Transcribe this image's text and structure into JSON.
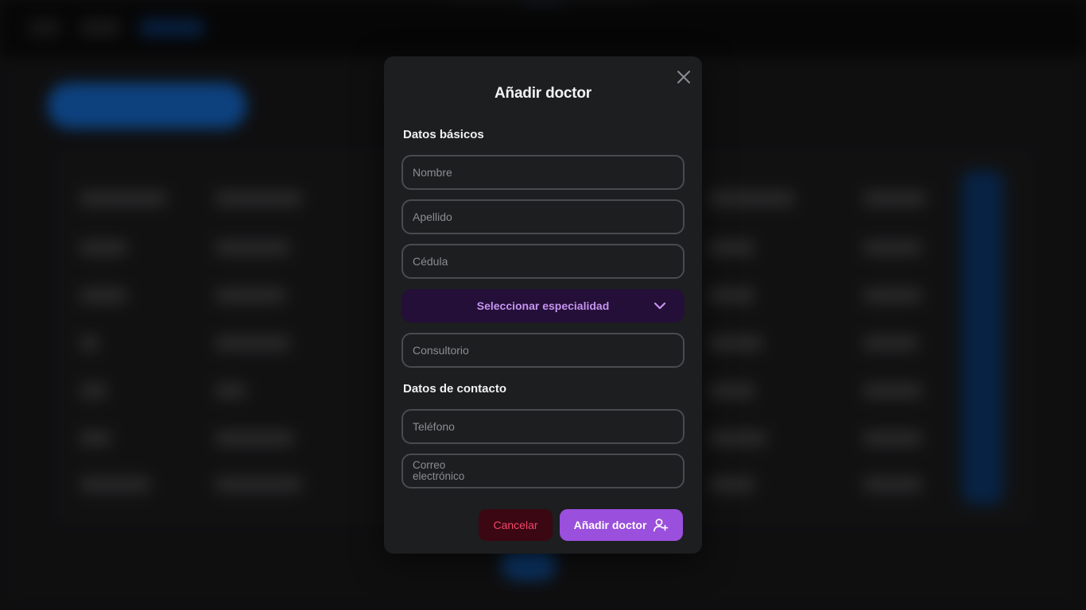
{
  "modal": {
    "title": "Añadir doctor",
    "sections": {
      "basic": "Datos básicos",
      "contact": "Datos de contacto"
    },
    "fields": {
      "nombre": {
        "placeholder": "Nombre",
        "value": ""
      },
      "apellido": {
        "placeholder": "Apellido",
        "value": ""
      },
      "cedula": {
        "placeholder": "Cédula",
        "value": ""
      },
      "consultorio": {
        "placeholder": "Consultorio",
        "value": ""
      },
      "telefono": {
        "placeholder": "Teléfono",
        "value": ""
      },
      "correo": {
        "placeholder": "Correo\nelectrónico",
        "value": ""
      }
    },
    "specialty_select": {
      "selected": "Seleccionar especialidad"
    },
    "buttons": {
      "cancel": "Cancelar",
      "submit": "Añadir doctor"
    },
    "icons": {
      "close": "close-icon",
      "chevron": "chevron-down-icon",
      "submit": "user-plus-icon"
    },
    "colors": {
      "accent": "#9a4fdd",
      "select_bg": "#240f38",
      "select_text": "#c594ef",
      "danger_bg": "#3b0712",
      "danger_text": "#f0466b",
      "background_accent": "#1877e6"
    }
  }
}
